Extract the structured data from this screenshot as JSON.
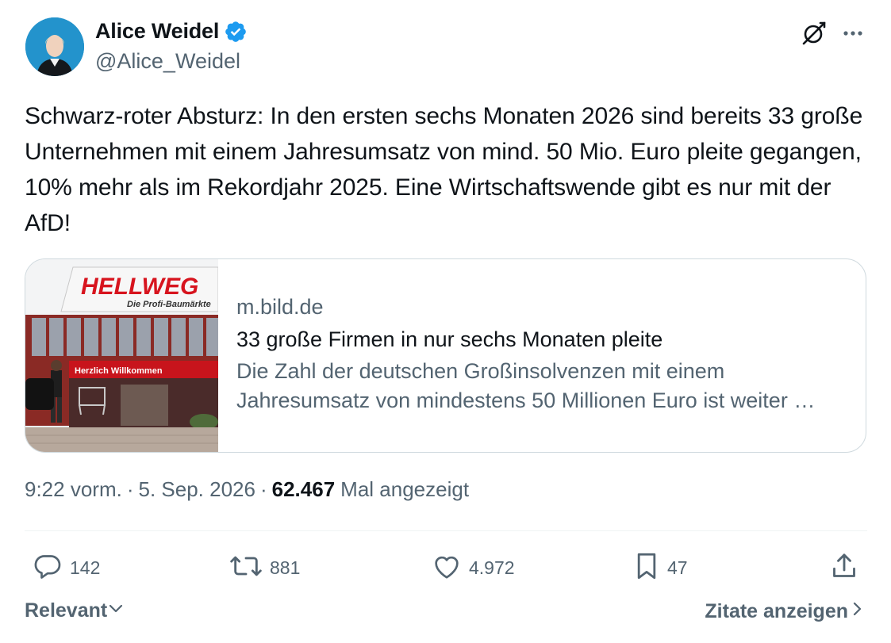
{
  "author": {
    "name": "Alice Weidel",
    "handle": "@Alice_Weidel",
    "verified_color": "#1d9bf0"
  },
  "tweet": {
    "text": "Schwarz-roter Absturz: In den ersten sechs Monaten 2026 sind bereits 33 große Unternehmen mit einem Jahresumsatz von mind. 50 Mio. Euro pleite gegangen, 10% mehr als im Rekordjahr 2025. Eine Wirtschaftswende gibt es nur mit der AfD!"
  },
  "card": {
    "image_sign_text": "HELLWEG",
    "image_sign_sub": "Die Profi-Baumärkte",
    "image_banner_text": "Herzlich Willkommen",
    "domain": "m.bild.de",
    "title": "33 große Firmen in nur sechs Monaten pleite",
    "description": "Die Zahl der deutschen Großinsolvenzen mit einem Jahresumsatz von mindestens 50 Millionen Euro ist weiter …"
  },
  "meta": {
    "time": "9:22 vorm.",
    "date": "5. Sep. 2026",
    "separator": "·",
    "views_count": "62.467",
    "views_label": "Mal angezeigt"
  },
  "actions": {
    "replies": "142",
    "reposts": "881",
    "likes": "4.972",
    "bookmarks": "47"
  },
  "footer": {
    "sort_label": "Relevant",
    "quotes_label": "Zitate anzeigen"
  },
  "icons": {
    "verified": "verified-badge-icon",
    "grok": "grok-icon",
    "more": "more-icon",
    "reply": "reply-icon",
    "repost": "repost-icon",
    "like": "heart-icon",
    "bookmark": "bookmark-icon",
    "share": "share-icon"
  },
  "colors": {
    "text_primary": "#0f1419",
    "text_secondary": "#536471",
    "border": "#cfd9de",
    "sign_red": "#d7141e"
  }
}
